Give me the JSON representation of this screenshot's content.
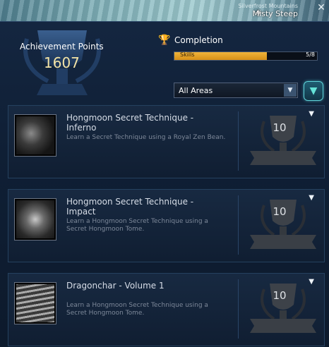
{
  "topbar": {
    "location_sub": "Silverfrost Mountains",
    "location_main": "Misty Steep"
  },
  "header": {
    "achievement_points_label": "Achievement Points",
    "achievement_points_value": "1607",
    "completion_label": "Completion",
    "progress_text": "Skills",
    "progress_count": "5/8",
    "progress_fraction": 0.65
  },
  "filter": {
    "area_selected": "All Areas"
  },
  "achievements": [
    {
      "title": "Hongmoon Secret Technique - Inferno",
      "description": "Learn a Secret Technique using a Royal Zen Bean.",
      "points": "10"
    },
    {
      "title": "Hongmoon Secret Technique - Impact",
      "description": "Learn a Hongmoon Secret Technique using a Secret Hongmoon Tome.",
      "points": "10"
    },
    {
      "title": "Dragonchar - Volume 1",
      "description": "Learn a Hongmoon Secret Technique using a Secret Hongmoon Tome.",
      "points": "10"
    }
  ],
  "colors": {
    "accent_orange": "#d68f17",
    "filter_cyan": "#5fd3d9",
    "points_gold": "#f2e3a6"
  },
  "icons": {
    "close": "close-icon",
    "compass": "compass-icon",
    "filter": "filter-icon",
    "trophy": "trophy-icon"
  }
}
